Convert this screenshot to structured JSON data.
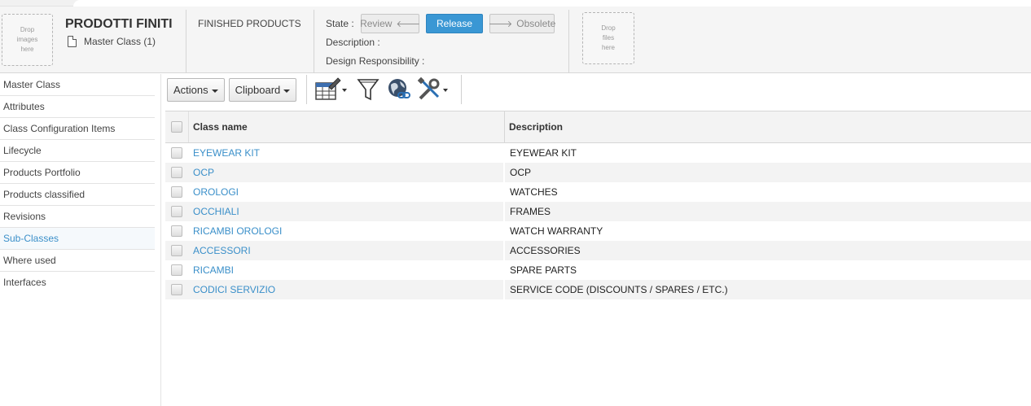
{
  "header": {
    "drop_images": "Drop\nimages\nhere",
    "drop_files": "Drop\nfiles\nhere",
    "title": "PRODOTTI FINITI",
    "master_class": "Master Class (1)",
    "subtitle": "FINISHED PRODUCTS",
    "state_label": "State :",
    "description_label": "Description :",
    "design_responsibility_label": "Design Responsibility :",
    "state_buttons": {
      "review": "Review",
      "release": "Release",
      "obsolete": "Obsolete"
    },
    "accent_color": "#3a97d4"
  },
  "sidebar": {
    "items": [
      {
        "label": "Master Class"
      },
      {
        "label": "Attributes"
      },
      {
        "label": "Class Configuration Items"
      },
      {
        "label": "Lifecycle"
      },
      {
        "label": "Products Portfolio"
      },
      {
        "label": "Products classified"
      },
      {
        "label": "Revisions"
      },
      {
        "label": "Sub-Classes",
        "active": true
      },
      {
        "label": "Where used"
      },
      {
        "label": "Interfaces"
      }
    ]
  },
  "toolbar": {
    "actions": "Actions",
    "clipboard": "Clipboard",
    "icons": [
      "table-edit-icon",
      "filter-icon",
      "globe-link-icon",
      "tools-icon"
    ]
  },
  "table": {
    "columns": [
      "Class name",
      "Description"
    ],
    "rows": [
      {
        "name": "EYEWEAR KIT",
        "description": "EYEWEAR KIT"
      },
      {
        "name": "OCP",
        "description": "OCP"
      },
      {
        "name": "OROLOGI",
        "description": "WATCHES"
      },
      {
        "name": "OCCHIALI",
        "description": "FRAMES"
      },
      {
        "name": "RICAMBI OROLOGI",
        "description": "WATCH WARRANTY"
      },
      {
        "name": "ACCESSORI",
        "description": "ACCESSORIES"
      },
      {
        "name": "RICAMBI",
        "description": "SPARE PARTS"
      },
      {
        "name": "CODICI SERVIZIO",
        "description": "SERVICE CODE (DISCOUNTS / SPARES / ETC.)"
      }
    ]
  }
}
